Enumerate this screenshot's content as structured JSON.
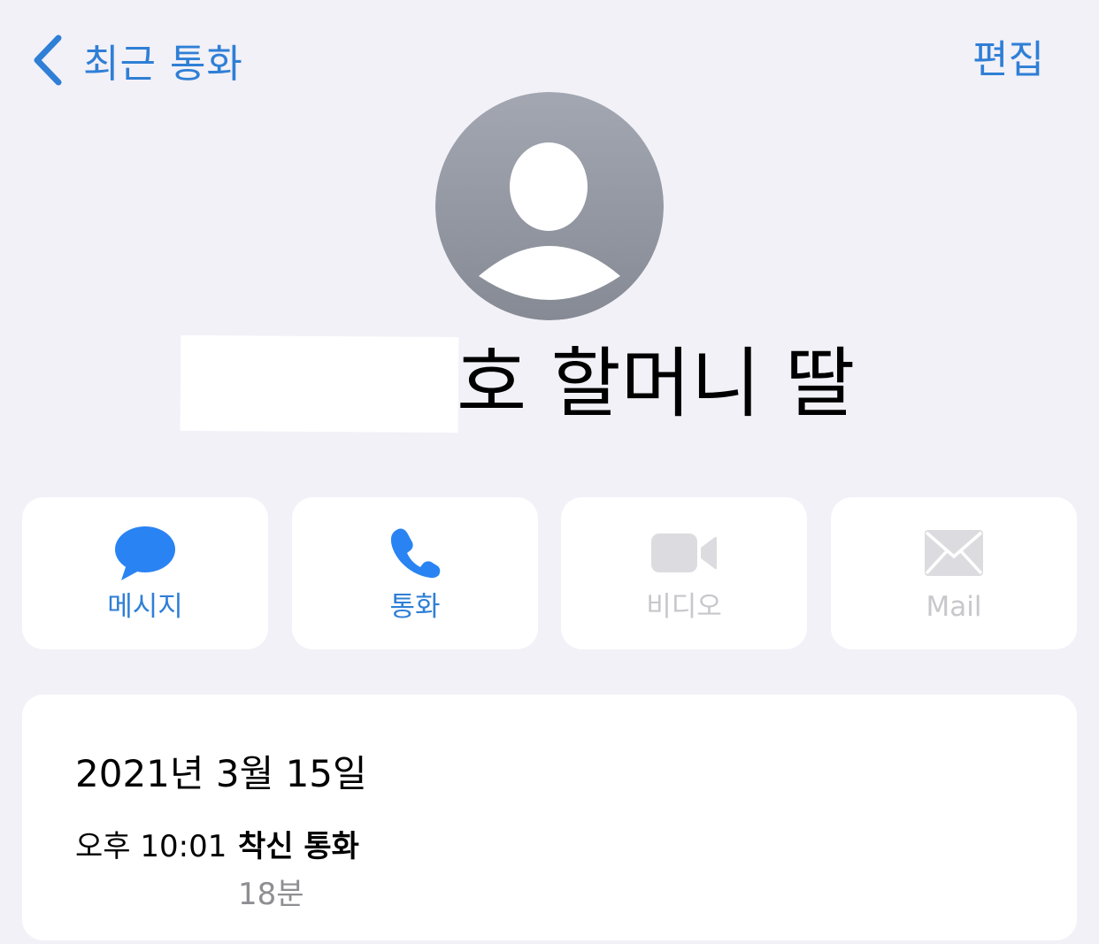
{
  "nav": {
    "back_label": "최근 통화",
    "edit_label": "편집",
    "back_icon": "chevron-left-icon"
  },
  "contact": {
    "avatar_icon": "person-silhouette-icon",
    "name_visible": "호 할머니 딸"
  },
  "actions": [
    {
      "label": "메시지",
      "icon": "message-bubble-icon",
      "enabled": true
    },
    {
      "label": "통화",
      "icon": "phone-icon",
      "enabled": true
    },
    {
      "label": "비디오",
      "icon": "video-camera-icon",
      "enabled": false
    },
    {
      "label": "Mail",
      "icon": "mail-envelope-icon",
      "enabled": false
    }
  ],
  "call_history": {
    "date": "2021년 3월 15일",
    "entries": [
      {
        "time": "오후 10:01",
        "type": "착신 통화",
        "duration": "18분"
      }
    ]
  },
  "colors": {
    "background": "#f2f1f7",
    "accent": "#2f7fd6",
    "disabled": "#c7c7cc",
    "secondary_text": "#8e8e93",
    "card": "#ffffff"
  }
}
